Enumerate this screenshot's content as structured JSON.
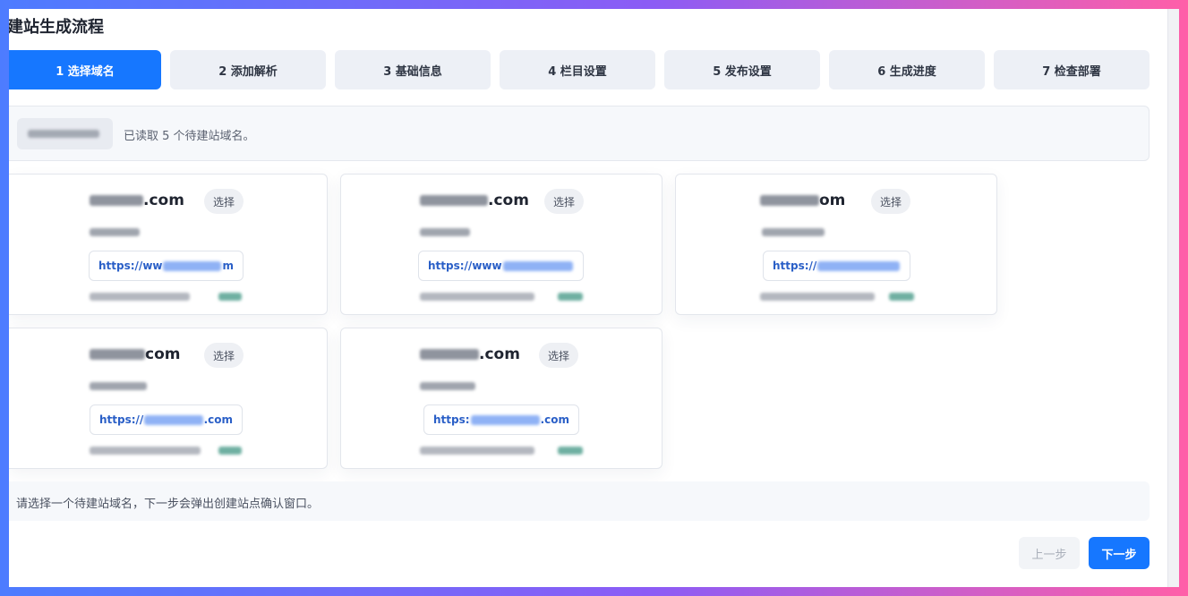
{
  "header": {
    "title": "建站生成流程"
  },
  "steps": [
    {
      "label": "1 选择域名",
      "active": true
    },
    {
      "label": "2 添加解析",
      "active": false
    },
    {
      "label": "3 基础信息",
      "active": false
    },
    {
      "label": "4 栏目设置",
      "active": false
    },
    {
      "label": "5 发布设置",
      "active": false
    },
    {
      "label": "6 生成进度",
      "active": false
    },
    {
      "label": "7 检查部署",
      "active": false
    }
  ],
  "summary": {
    "text": "已读取 5 个待建站域名。"
  },
  "domains": [
    {
      "domain_suffix": ".com",
      "select_label": "选择",
      "url_prefix": "https://ww",
      "url_suffix": "m"
    },
    {
      "domain_suffix": ".com",
      "select_label": "选择",
      "url_prefix": "https://www",
      "url_suffix": ""
    },
    {
      "domain_suffix": "om",
      "select_label": "选择",
      "url_prefix": "https://",
      "url_suffix": ""
    },
    {
      "domain_suffix": "com",
      "select_label": "选择",
      "url_prefix": "https://",
      "url_suffix": ".com"
    },
    {
      "domain_suffix": ".com",
      "select_label": "选择",
      "url_prefix": "https:",
      "url_suffix": ".com"
    }
  ],
  "hint": {
    "text": "请选择一个待建站域名，下一步会弹出创建站点确认窗口。"
  },
  "footer": {
    "prev_label": "上一步",
    "next_label": "下一步"
  },
  "colors": {
    "accent": "#1677ff",
    "url_text": "#2a5fc7",
    "status_tag": "#5fa89a"
  }
}
